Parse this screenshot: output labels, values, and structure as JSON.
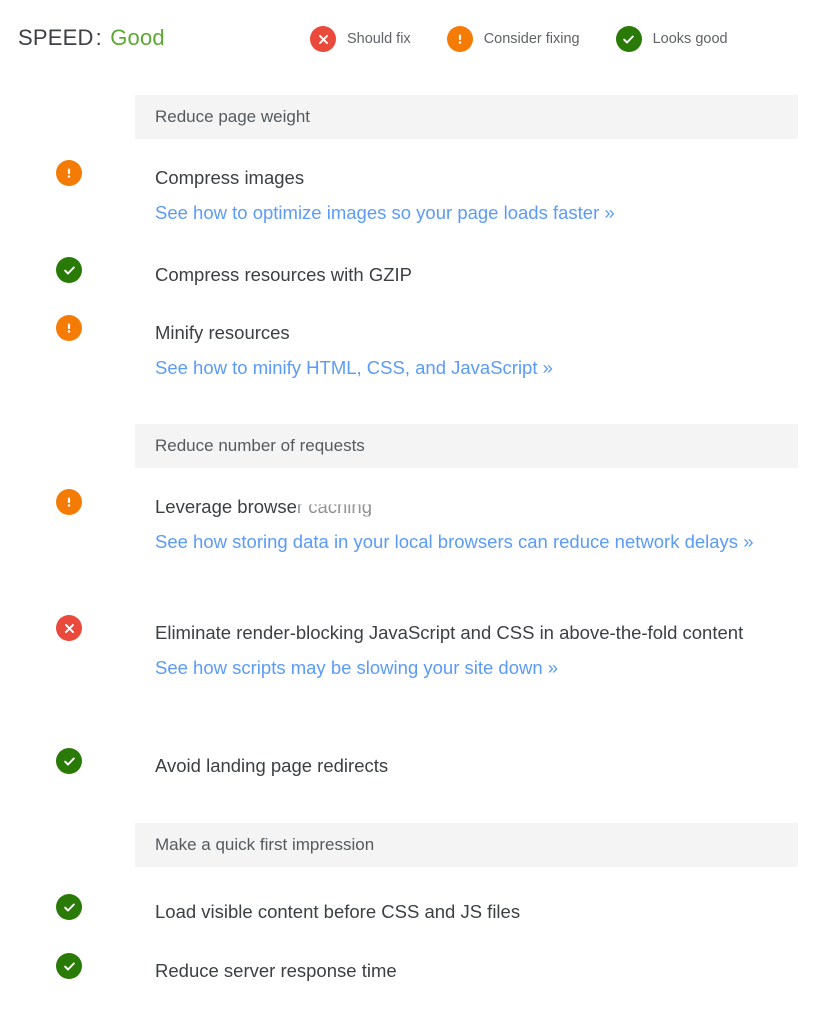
{
  "header": {
    "score_label": "SPEED",
    "separator": ":",
    "score_value": "Good",
    "legend": [
      {
        "icon": "error-circle-icon",
        "label": "Should fix",
        "color": "#ea4a3c"
      },
      {
        "icon": "warning-circle-icon",
        "label": "Consider fixing",
        "color": "#f47b06"
      },
      {
        "icon": "check-circle-icon",
        "label": "Looks good",
        "color": "#2a7a08"
      }
    ]
  },
  "colors": {
    "good_green": "#5ca832",
    "error_red": "#ea4a3c",
    "warning_orange": "#f47b06",
    "ok_green": "#2a7a08",
    "link_blue": "#5b9bf8",
    "banner_gray": "#f4f4f4",
    "text_gray": "#3c4043"
  },
  "sections": [
    {
      "title": "Reduce page weight",
      "items": [
        {
          "status": "warning",
          "title": "Compress images",
          "link": "See how to optimize images so your page loads faster »"
        },
        {
          "status": "ok",
          "title": "Compress resources with GZIP",
          "link": null
        },
        {
          "status": "warning",
          "title": "Minify resources",
          "link": "See how to minify HTML, CSS, and JavaScript »"
        }
      ]
    },
    {
      "title": "Reduce number of requests",
      "items": [
        {
          "status": "warning",
          "title": "Leverage browser caching",
          "title_rendered_prefix": "Leverage browse",
          "title_rendered_glitch": "r caching",
          "link": "See how storing data in your local browsers can reduce network delays »"
        },
        {
          "status": "error",
          "title": "Eliminate render-blocking JavaScript and CSS in above-the-fold content",
          "link": "See how scripts may be slowing your site down »"
        },
        {
          "status": "ok",
          "title": "Avoid landing page redirects",
          "link": null
        }
      ]
    },
    {
      "title": "Make a quick first impression",
      "items": [
        {
          "status": "ok",
          "title": "Load visible content before CSS and JS files",
          "link": null
        },
        {
          "status": "ok",
          "title": "Reduce server response time",
          "link": null
        }
      ]
    }
  ]
}
